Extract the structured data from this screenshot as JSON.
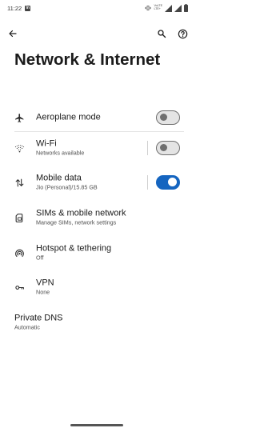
{
  "status_bar": {
    "time": "11:22",
    "app_badge": "in",
    "volte_top": "VoLTE",
    "volte_mid": "LTE+",
    "volte_bot": "LTE"
  },
  "header": {
    "title": "Network & Internet"
  },
  "settings": [
    {
      "title": "Aeroplane mode",
      "subtitle": "",
      "icon": "airplane-icon",
      "toggle": false
    },
    {
      "title": "Wi-Fi",
      "subtitle": "Networks available",
      "icon": "wifi-icon",
      "toggle": false
    },
    {
      "title": "Mobile data",
      "subtitle": "Jio (Personal)/15.85 GB",
      "icon": "mobile-data-icon",
      "toggle": true
    },
    {
      "title": "SIMs & mobile network",
      "subtitle": "Manage SIMs, network settings",
      "icon": "sim-card-icon"
    },
    {
      "title": "Hotspot & tethering",
      "subtitle": "Off",
      "icon": "hotspot-icon"
    },
    {
      "title": "VPN",
      "subtitle": "None",
      "icon": "vpn-key-icon"
    },
    {
      "title": "Private DNS",
      "subtitle": "Automatic",
      "icon": ""
    }
  ],
  "colors": {
    "accent": "#1565c0",
    "toggle_off": "#6f6f6f",
    "text_primary": "#1b1b1b",
    "text_secondary": "#505050"
  }
}
